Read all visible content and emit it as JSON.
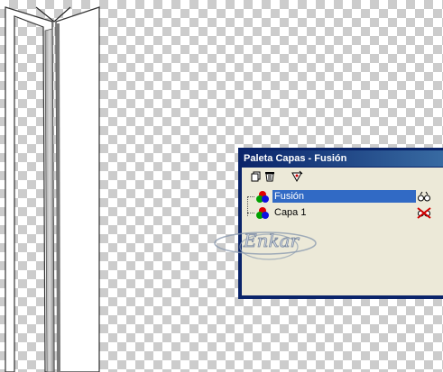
{
  "palette": {
    "title": "Paleta Capas - Fusión",
    "toolbar": {
      "icons": [
        "new-layer-icon",
        "delete-layer-icon",
        "layer-properties-icon"
      ]
    },
    "layers": [
      {
        "name": "Fusión",
        "selected": true,
        "visibility": "visible"
      },
      {
        "name": "Capa 1",
        "selected": false,
        "visibility": "hidden"
      }
    ]
  },
  "watermark": {
    "text": "Enkar"
  },
  "colors": {
    "title_bar": "#0a246a",
    "panel": "#ece9d8",
    "selection": "#316ac5",
    "checker_dark": "#cccccc",
    "checker_light": "#ffffff"
  }
}
